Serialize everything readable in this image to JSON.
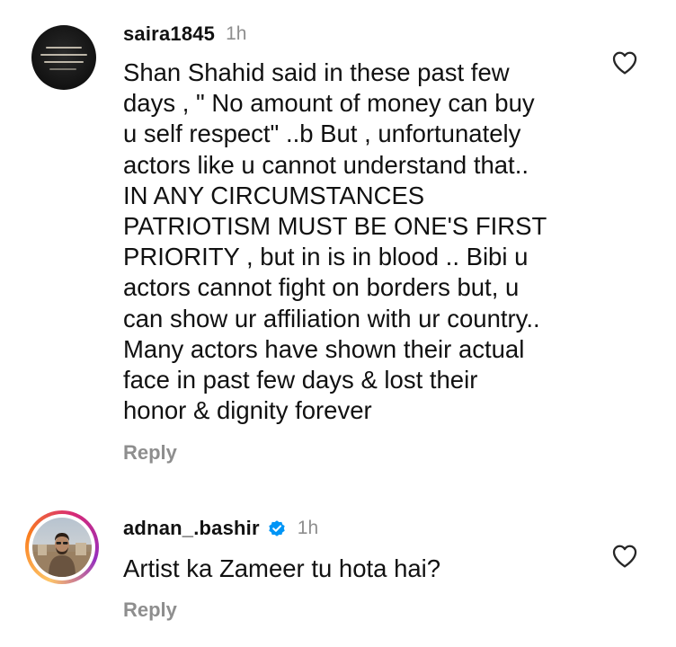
{
  "comments": [
    {
      "username": "saira1845",
      "time": "1h",
      "verified": false,
      "text": "Shan Shahid said in these past few\ndays , \" No amount of money can buy\nu self respect\" ..b But , unfortunately\nactors like u cannot understand that..\nIN ANY CIRCUMSTANCES\nPATRIOTISM MUST BE ONE'S FIRST\nPRIORITY , but in is in blood .. Bibi u\nactors cannot fight on borders but, u\ncan show ur affiliation with ur country..\nMany actors have shown their actual\nface in past few days & lost their\nhonor & dignity forever",
      "reply_label": "Reply"
    },
    {
      "username": "adnan_.bashir",
      "time": "1h",
      "verified": true,
      "text": "Artist ka Zameer tu hota hai?",
      "reply_label": "Reply"
    }
  ],
  "colors": {
    "text": "#111111",
    "muted": "#8e8e8e",
    "verified": "#0095f6",
    "story_ring": [
      "#fdc468",
      "#fa7e1e",
      "#d62976",
      "#962fbf"
    ]
  },
  "icons": {
    "like": "heart-outline-icon",
    "verified": "verified-badge-icon"
  }
}
